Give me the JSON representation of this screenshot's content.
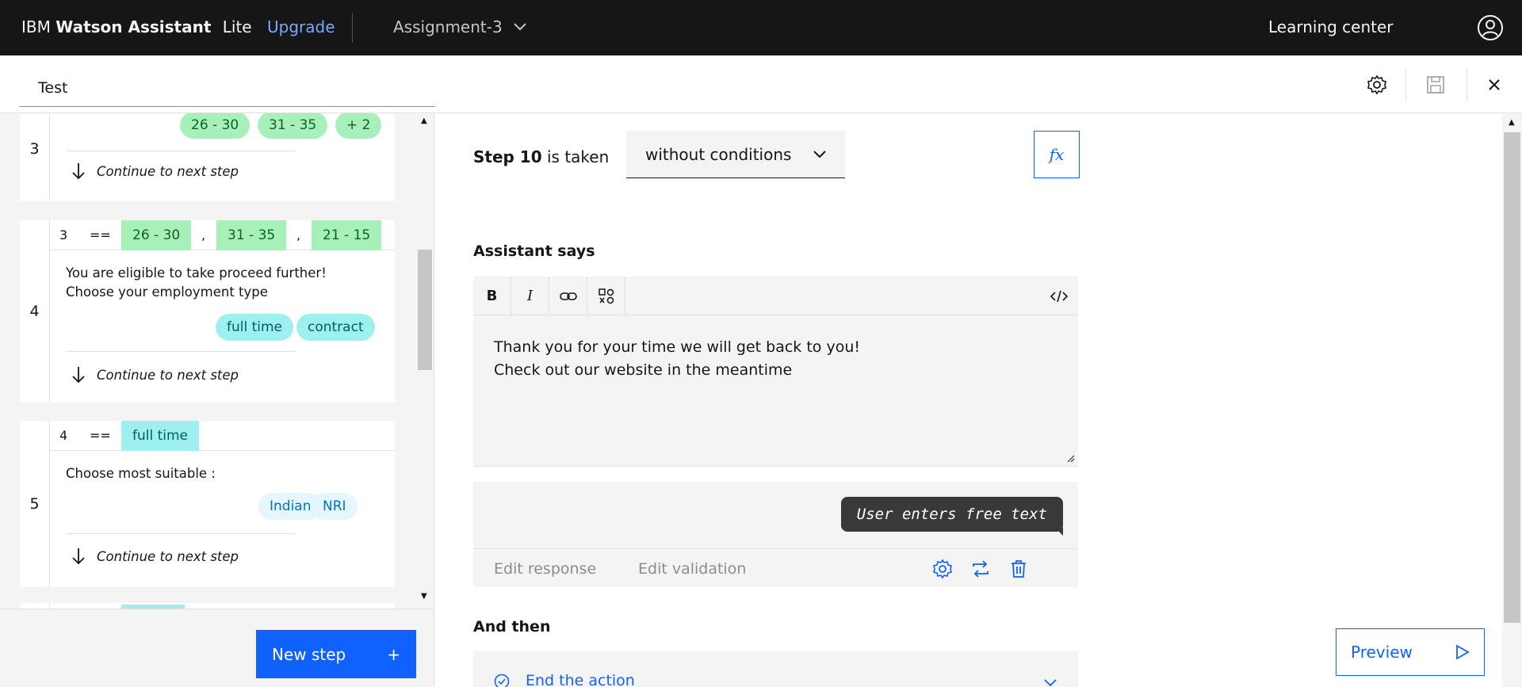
{
  "header": {
    "brand_ibm": "IBM",
    "brand_name": "Watson Assistant",
    "brand_plan": "Lite",
    "upgrade": "Upgrade",
    "assistant": "Assignment-3",
    "learning_center": "Learning center"
  },
  "subheader": {
    "tab": "Test"
  },
  "steps": {
    "step3": {
      "number": "3",
      "chips": [
        "26 - 30",
        "31 - 35",
        "+ 2"
      ],
      "continue": "Continue to next step"
    },
    "step4": {
      "number": "4",
      "cond_step": "3",
      "cond_op": "==",
      "cond_values": [
        "26 - 30",
        "31 - 35",
        "21 - 15"
      ],
      "cond_sep": ",",
      "text_line1": "You are eligible to take proceed further!",
      "text_line2": "Choose your employment type",
      "chips": [
        "full time",
        "contract"
      ],
      "continue": "Continue to next step"
    },
    "step5": {
      "number": "5",
      "cond_step": "4",
      "cond_op": "==",
      "cond_value": "full time",
      "text": "Choose most suitable :",
      "chips": [
        "Indian",
        "NRI"
      ],
      "continue": "Continue to next step"
    }
  },
  "left_footer": {
    "new_step": "New step",
    "new_step_icon": "+"
  },
  "main": {
    "step_label": "Step 10",
    "step_suffix": "is taken",
    "condition_select": "without conditions",
    "fx": "fx",
    "assistant_says": "Assistant says",
    "toolbar": {
      "bold": "B",
      "italic": "I"
    },
    "editor_line1": "Thank you for your time we will get back to you!",
    "editor_line2": "Check out our website in the meantime",
    "user_bubble": "User enters free text",
    "edit_response": "Edit response",
    "edit_validation": "Edit validation",
    "and_then": "And then",
    "end_action": "End the action",
    "preview": "Preview"
  },
  "colors": {
    "accent": "#0f62fe",
    "header_bg": "#161616",
    "green_tag": "#a7f0ba",
    "teal_tag": "#9ef0f0",
    "blue_tag": "#e5f6ff"
  }
}
